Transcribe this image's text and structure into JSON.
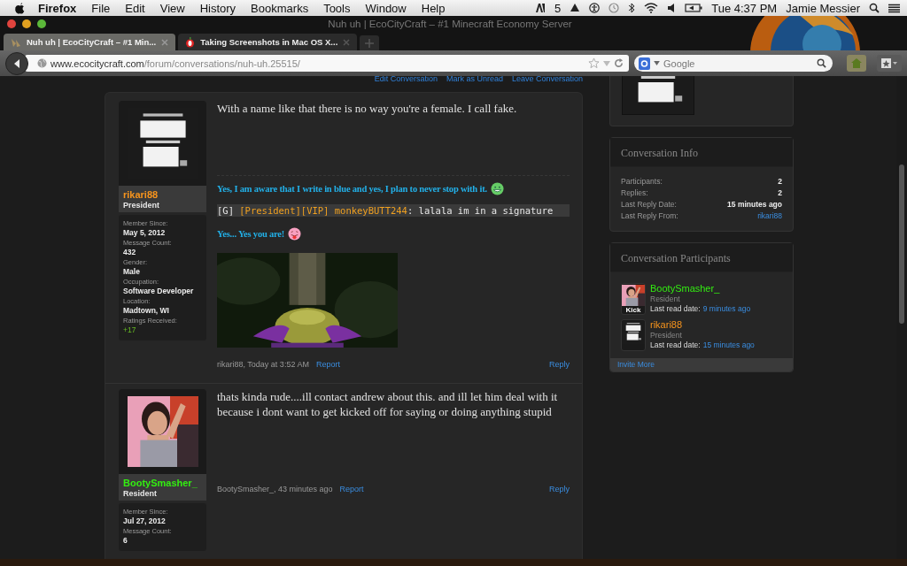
{
  "menubar": {
    "app": "Firefox",
    "menus": [
      "File",
      "Edit",
      "View",
      "History",
      "Bookmarks",
      "Tools",
      "Window",
      "Help"
    ],
    "badge_count": "5",
    "clock": "Tue 4:37 PM",
    "user": "Jamie Messier"
  },
  "window": {
    "title": "Nuh uh | EcoCityCraft – #1 Minecraft Economy Server"
  },
  "tabs": [
    {
      "label": "Nuh uh | EcoCityCraft – #1 Min...",
      "selected": true
    },
    {
      "label": "Taking Screenshots in Mac OS X...",
      "selected": false
    }
  ],
  "toolbar": {
    "url_host": "www.ecocitycraft.com",
    "url_path": "/forum/conversations/nuh-uh.25515/",
    "search_placeholder": "Google"
  },
  "conversation_actions": [
    "Edit Conversation",
    "Mark as Unread",
    "Leave Conversation"
  ],
  "posts": [
    {
      "username": "rikari88",
      "color": "#f7941d",
      "user_title": "President",
      "stats": [
        {
          "label": "Member Since:",
          "value": "May 5, 2012",
          "kind": "text"
        },
        {
          "label": "Message Count:",
          "value": "432",
          "kind": "text"
        },
        {
          "label": "Gender:",
          "value": "Male",
          "kind": "text"
        },
        {
          "label": "Occupation:",
          "value": "Software Developer",
          "kind": "text"
        },
        {
          "label": "Location:",
          "value": "Madtown, WI",
          "kind": "text"
        },
        {
          "label": "Ratings Received:",
          "value": "+17",
          "kind": "rating"
        }
      ],
      "body": "With a name like that there is no way you're a female. I call fake.",
      "signature": [
        {
          "kind": "blue_text",
          "text": "Yes, I am aware that I write in blue and yes, I plan to never stop with it."
        },
        {
          "kind": "chat",
          "parts": [
            {
              "text": "[G] ",
              "color": "#e8e8e8"
            },
            {
              "text": "[President][VIP] monkeyBUTT244",
              "color": "#f0a020"
            },
            {
              "text": ": lalala im in a signature",
              "color": "#e8e8e8"
            }
          ]
        },
        {
          "kind": "blue_text",
          "text": "Yes... Yes you are!"
        },
        {
          "kind": "picture"
        }
      ],
      "meta": "rikari88, Today at 3:52 AM",
      "report": "Report",
      "reply": "Reply"
    },
    {
      "username": "BootySmasher_",
      "color": "#33ee11",
      "user_title": "Resident",
      "stats": [
        {
          "label": "Member Since:",
          "value": "Jul 27, 2012",
          "kind": "text"
        },
        {
          "label": "Message Count:",
          "value": "6",
          "kind": "text"
        }
      ],
      "body": "thats kinda rude....ill contact andrew about this. and ill let him deal with it because i dont want to get kicked off for saying or doing anything stupid",
      "meta": "BootySmasher_, 43 minutes ago",
      "report": "Report",
      "reply": "Reply"
    }
  ],
  "sidebar": {
    "info": {
      "title": "Conversation Info",
      "rows": [
        {
          "label": "Participants:",
          "value": "2",
          "kind": "text"
        },
        {
          "label": "Replies:",
          "value": "2",
          "kind": "text"
        },
        {
          "label": "Last Reply Date:",
          "value": "15 minutes ago",
          "kind": "text"
        },
        {
          "label": "Last Reply From:",
          "value": "rikari88",
          "kind": "link"
        }
      ]
    },
    "participants": {
      "title": "Conversation Participants",
      "items": [
        {
          "name": "BootySmasher_",
          "color": "#33ee11",
          "user_title": "Resident",
          "avatar_caption": "Kick",
          "read_label": "Last read date:",
          "read_time": "9 minutes ago"
        },
        {
          "name": "rikari88",
          "color": "#f7941d",
          "user_title": "President",
          "read_label": "Last read date:",
          "read_time": "15 minutes ago"
        }
      ],
      "invite": "Invite More"
    }
  }
}
